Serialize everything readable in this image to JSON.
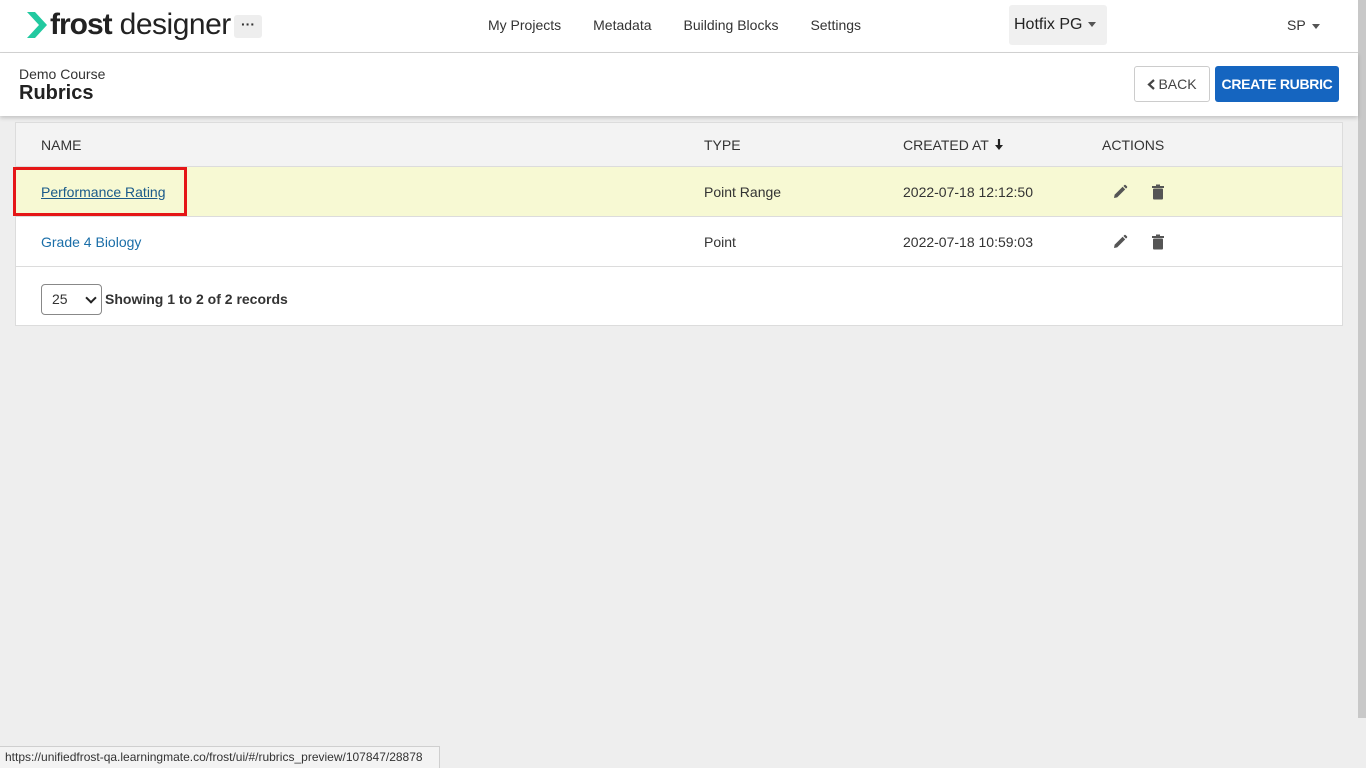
{
  "brand": {
    "bold": "frost",
    "light": "designer",
    "logo_icon": "chevron-logo-icon",
    "accent": "#22c9a0"
  },
  "header": {
    "more_label": "···",
    "nav": [
      "My Projects",
      "Metadata",
      "Building Blocks",
      "Settings"
    ],
    "project_label": "Hotfix PG",
    "user_label": "SP"
  },
  "page": {
    "breadcrumb": "Demo Course",
    "title": "Rubrics",
    "back_label": "BACK",
    "create_label": "CREATE RUBRIC"
  },
  "table": {
    "columns": [
      "NAME",
      "TYPE",
      "CREATED AT",
      "ACTIONS"
    ],
    "sort_indicator": "arrow-down-icon",
    "rows": [
      {
        "name": "Performance Rating",
        "type": "Point Range",
        "created_at": "2022-07-18 12:12:50"
      },
      {
        "name": "Grade 4 Biology",
        "type": "Point",
        "created_at": "2022-07-18 10:59:03"
      }
    ],
    "page_size": "25",
    "summary": "Showing 1 to 2 of 2 records"
  },
  "status_url": "https://unifiedfrost-qa.learningmate.co/frost/ui/#/rubrics_preview/107847/28878",
  "colors": {
    "primary": "#1565c0",
    "highlight_row": "#f7f9d3",
    "annotation_box": "#e51616",
    "link": "#1a6ea8"
  }
}
